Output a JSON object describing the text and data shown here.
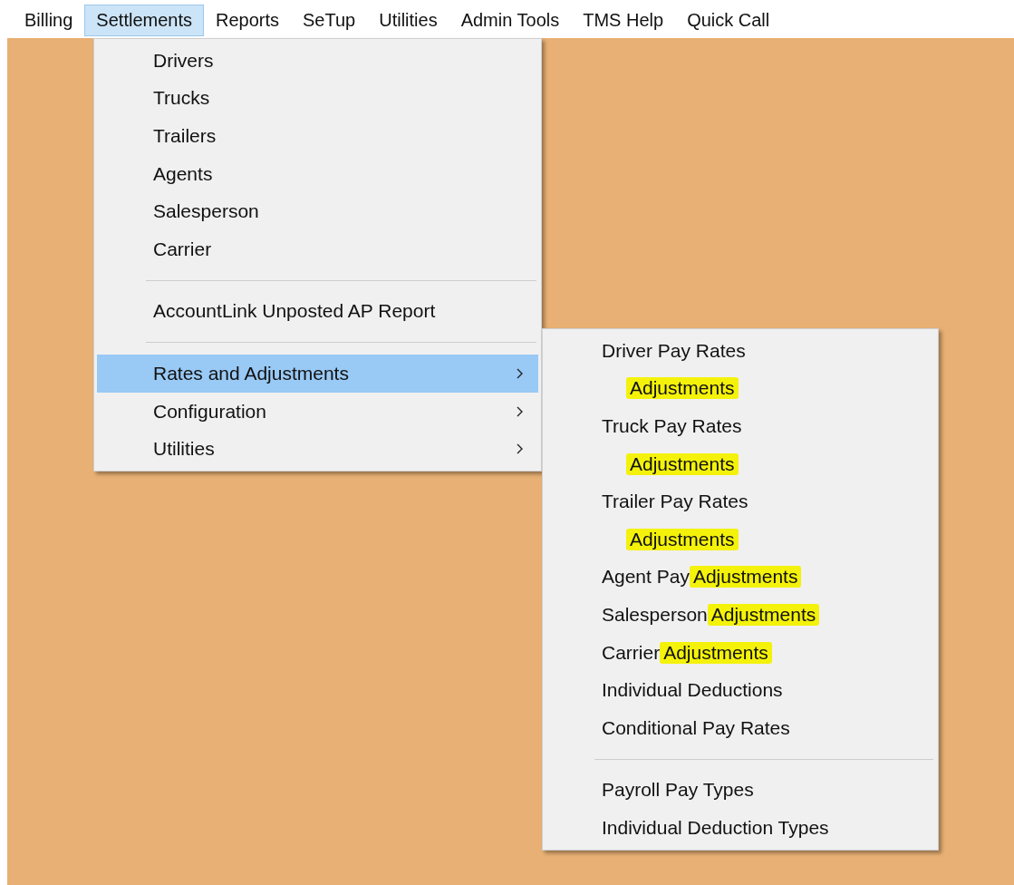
{
  "menu_bar": [
    {
      "label": "Billing",
      "selected": false
    },
    {
      "label": "Settlements",
      "selected": true
    },
    {
      "label": "Reports",
      "selected": false
    },
    {
      "label": "SeTup",
      "selected": false
    },
    {
      "label": "Utilities",
      "selected": false
    },
    {
      "label": "Admin Tools",
      "selected": false
    },
    {
      "label": "TMS Help",
      "selected": false
    },
    {
      "label": "Quick Call",
      "selected": false
    }
  ],
  "settlements_menu": [
    {
      "kind": "item",
      "label": "Drivers",
      "selected": false,
      "has_submenu": false
    },
    {
      "kind": "item",
      "label": "Trucks",
      "selected": false,
      "has_submenu": false
    },
    {
      "kind": "item",
      "label": "Trailers",
      "selected": false,
      "has_submenu": false
    },
    {
      "kind": "item",
      "label": "Agents",
      "selected": false,
      "has_submenu": false
    },
    {
      "kind": "item",
      "label": "Salesperson",
      "selected": false,
      "has_submenu": false
    },
    {
      "kind": "item",
      "label": "Carrier",
      "selected": false,
      "has_submenu": false
    },
    {
      "kind": "separator"
    },
    {
      "kind": "item",
      "label": "AccountLink Unposted AP Report",
      "selected": false,
      "has_submenu": false
    },
    {
      "kind": "separator"
    },
    {
      "kind": "item",
      "label": "Rates and Adjustments",
      "selected": true,
      "has_submenu": true
    },
    {
      "kind": "item",
      "label": "Configuration",
      "selected": false,
      "has_submenu": true
    },
    {
      "kind": "item",
      "label": "Utilities",
      "selected": false,
      "has_submenu": true
    }
  ],
  "rates_submenu": [
    {
      "kind": "item",
      "indented": false,
      "parts": [
        {
          "text": "Driver Pay Rates",
          "highlighted": false
        }
      ]
    },
    {
      "kind": "item",
      "indented": true,
      "parts": [
        {
          "text": "Adjustments",
          "highlighted": true
        }
      ]
    },
    {
      "kind": "item",
      "indented": false,
      "parts": [
        {
          "text": "Truck Pay Rates",
          "highlighted": false
        }
      ]
    },
    {
      "kind": "item",
      "indented": true,
      "parts": [
        {
          "text": "Adjustments",
          "highlighted": true
        }
      ]
    },
    {
      "kind": "item",
      "indented": false,
      "parts": [
        {
          "text": "Trailer Pay Rates",
          "highlighted": false
        }
      ]
    },
    {
      "kind": "item",
      "indented": true,
      "parts": [
        {
          "text": "Adjustments",
          "highlighted": true
        }
      ]
    },
    {
      "kind": "item",
      "indented": false,
      "parts": [
        {
          "text": "Agent Pay",
          "highlighted": false
        },
        {
          "text": "Adjustments",
          "highlighted": true
        }
      ]
    },
    {
      "kind": "item",
      "indented": false,
      "parts": [
        {
          "text": "Salesperson",
          "highlighted": false
        },
        {
          "text": "Adjustments",
          "highlighted": true
        }
      ]
    },
    {
      "kind": "item",
      "indented": false,
      "parts": [
        {
          "text": "Carrier",
          "highlighted": false
        },
        {
          "text": "Adjustments",
          "highlighted": true
        }
      ]
    },
    {
      "kind": "item",
      "indented": false,
      "parts": [
        {
          "text": "Individual Deductions",
          "highlighted": false
        }
      ]
    },
    {
      "kind": "item",
      "indented": false,
      "parts": [
        {
          "text": "Conditional Pay Rates",
          "highlighted": false
        }
      ]
    },
    {
      "kind": "separator"
    },
    {
      "kind": "item",
      "indented": false,
      "parts": [
        {
          "text": "Payroll Pay Types",
          "highlighted": false
        }
      ]
    },
    {
      "kind": "item",
      "indented": false,
      "parts": [
        {
          "text": "Individual Deduction Types",
          "highlighted": false
        }
      ]
    }
  ]
}
